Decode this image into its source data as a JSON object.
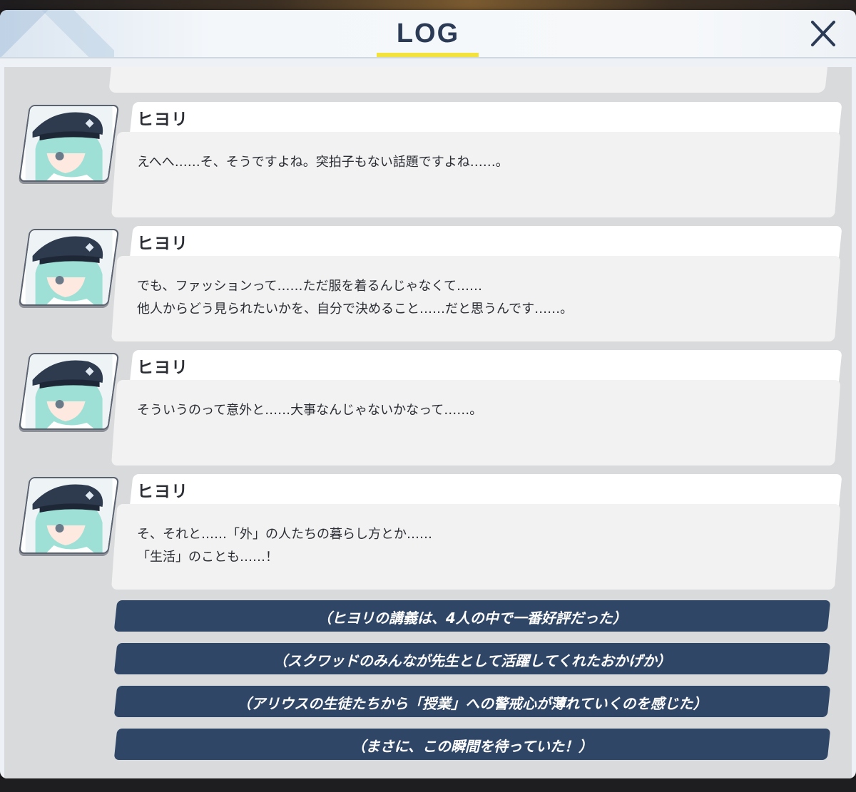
{
  "header": {
    "title": "LOG",
    "close_label": "✕"
  },
  "colors": {
    "accent_underline": "#f4e23c",
    "title_text": "#2b3a55",
    "choice_bg": "#2f4667",
    "bubble_bg": "#f2f2f2"
  },
  "entries": [
    {
      "name": "ヒヨリ",
      "lines": [
        "えへへ……そ、そうですよね。突拍子もない話題ですよね……。"
      ],
      "avatar": "hiyori-avatar"
    },
    {
      "name": "ヒヨリ",
      "lines": [
        "でも、ファッションって……ただ服を着るんじゃなくて……",
        "他人からどう見られたいかを、自分で決めること……だと思うんです……。"
      ],
      "avatar": "hiyori-avatar"
    },
    {
      "name": "ヒヨリ",
      "lines": [
        "そういうのって意外と……大事なんじゃないかなって……。"
      ],
      "avatar": "hiyori-avatar"
    },
    {
      "name": "ヒヨリ",
      "lines": [
        "そ、それと……「外」の人たちの暮らし方とか……",
        "「生活」のことも……！"
      ],
      "avatar": "hiyori-avatar"
    }
  ],
  "choices": [
    "（ヒヨリの講義は、4人の中で一番好評だった）",
    "（スクワッドのみんなが先生として活躍してくれたおかげか）",
    "（アリウスの生徒たちから「授業」への警戒心が薄れていくのを感じた）",
    "（まさに、この瞬間を待っていた！）"
  ]
}
